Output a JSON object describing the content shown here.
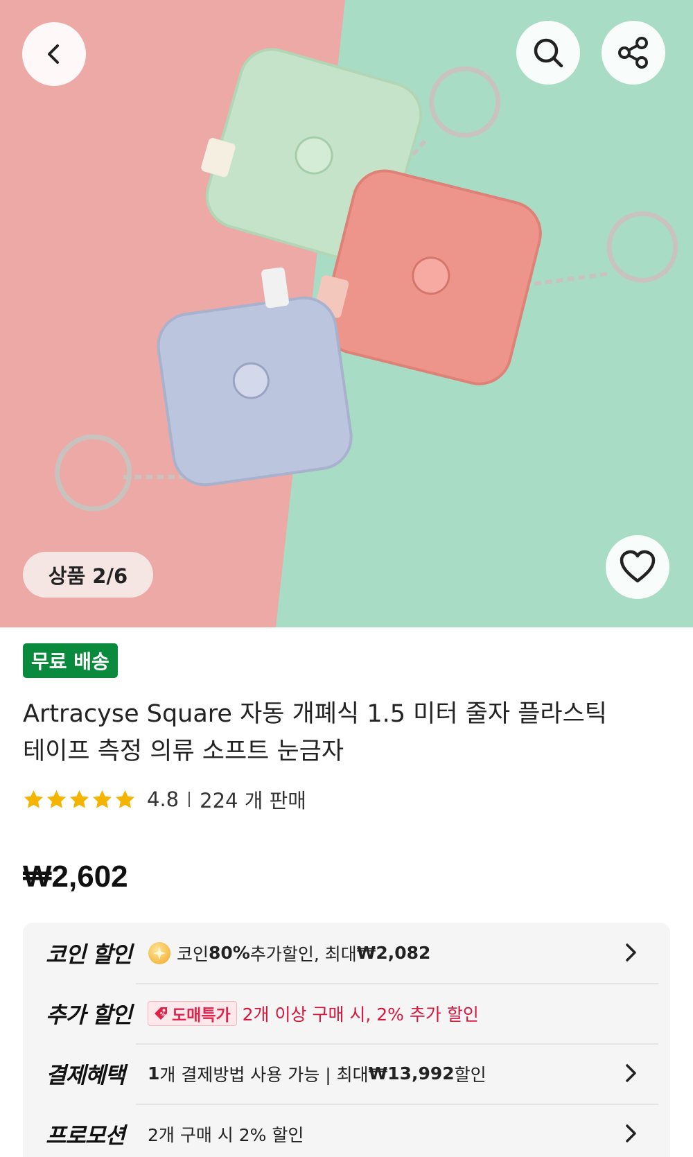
{
  "hero": {
    "counter": "상품 2/6",
    "icons": {
      "back": "chevron-left-icon",
      "search": "search-icon",
      "share": "share-icon",
      "wishlist": "heart-icon"
    },
    "colors": {
      "pink_bg": "#eca9a6",
      "mint_bg": "#a9dcc4"
    }
  },
  "shipping_badge": "무료 배송",
  "product": {
    "title_line1": "Artracyse Square 자동 개폐식 1.5 미터 줄자 플라스틱",
    "title_line2": "테이프 측정 의류 소프트 눈금자",
    "rating": "4.8",
    "stars": 4.8,
    "sold": "224 개 판매",
    "price": "₩2,602"
  },
  "benefits": [
    {
      "label": "코인 할인",
      "icon": "coin-icon",
      "text_pre": "코인 ",
      "text_bold1": "80%",
      "text_mid": " 추가할인, 최대 ",
      "text_bold2": "₩2,082",
      "has_chevron": true
    },
    {
      "label": "추가 할인",
      "tag": "도매특가",
      "text": "2개 이상 구매 시, 2% 추가 할인",
      "has_chevron": false
    },
    {
      "label": "결제혜택",
      "text_bold1": "1",
      "text_mid": "개 결제방법 사용 가능 | 최대 ",
      "text_bold2": "₩13,992",
      "text_post": " 할인",
      "has_chevron": true
    },
    {
      "label": "프로모션",
      "text": "2개 구매 시 2% 할인",
      "has_chevron": true
    }
  ],
  "colors": {
    "accent_green": "#0a8a3c",
    "star": "#f5b400",
    "promo_red": "#d8163c"
  }
}
